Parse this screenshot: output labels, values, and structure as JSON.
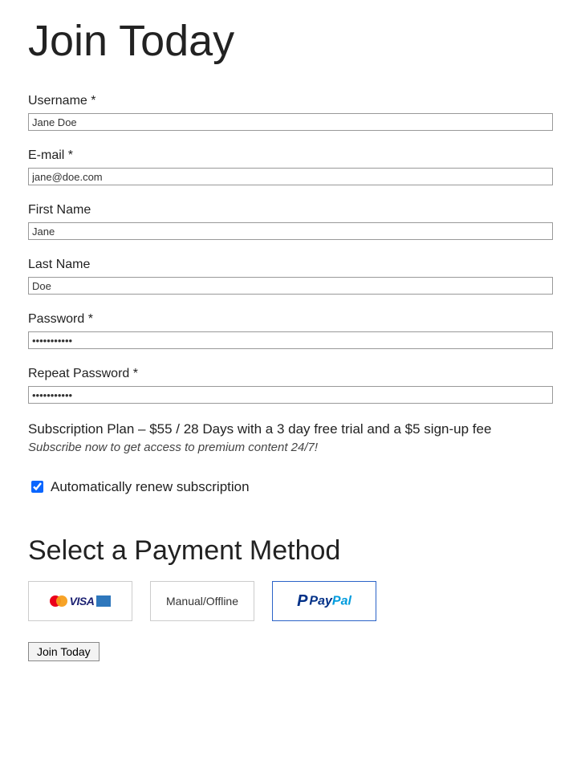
{
  "title": "Join Today",
  "fields": {
    "username": {
      "label": "Username *",
      "value": "Jane Doe"
    },
    "email": {
      "label": "E-mail *",
      "value": "jane@doe.com"
    },
    "first": {
      "label": "First Name",
      "value": "Jane"
    },
    "last": {
      "label": "Last Name",
      "value": "Doe"
    },
    "password": {
      "label": "Password *",
      "value": "•••••••••••"
    },
    "repeat": {
      "label": "Repeat Password *",
      "value": "•••••••••••"
    }
  },
  "plan": {
    "text": "Subscription Plan – $55 / 28 Days with a 3 day free trial and a $5 sign-up fee",
    "note": "Subscribe now to get access to premium content 24/7!"
  },
  "autorenew": {
    "label": "Automatically renew subscription",
    "checked": true
  },
  "payment": {
    "title": "Select a Payment Method",
    "methods": {
      "cards_visa": "VISA",
      "manual": "Manual/Offline",
      "paypal_pay": "Pay",
      "paypal_pal": "Pal"
    },
    "selected": "paypal"
  },
  "submit": "Join Today"
}
